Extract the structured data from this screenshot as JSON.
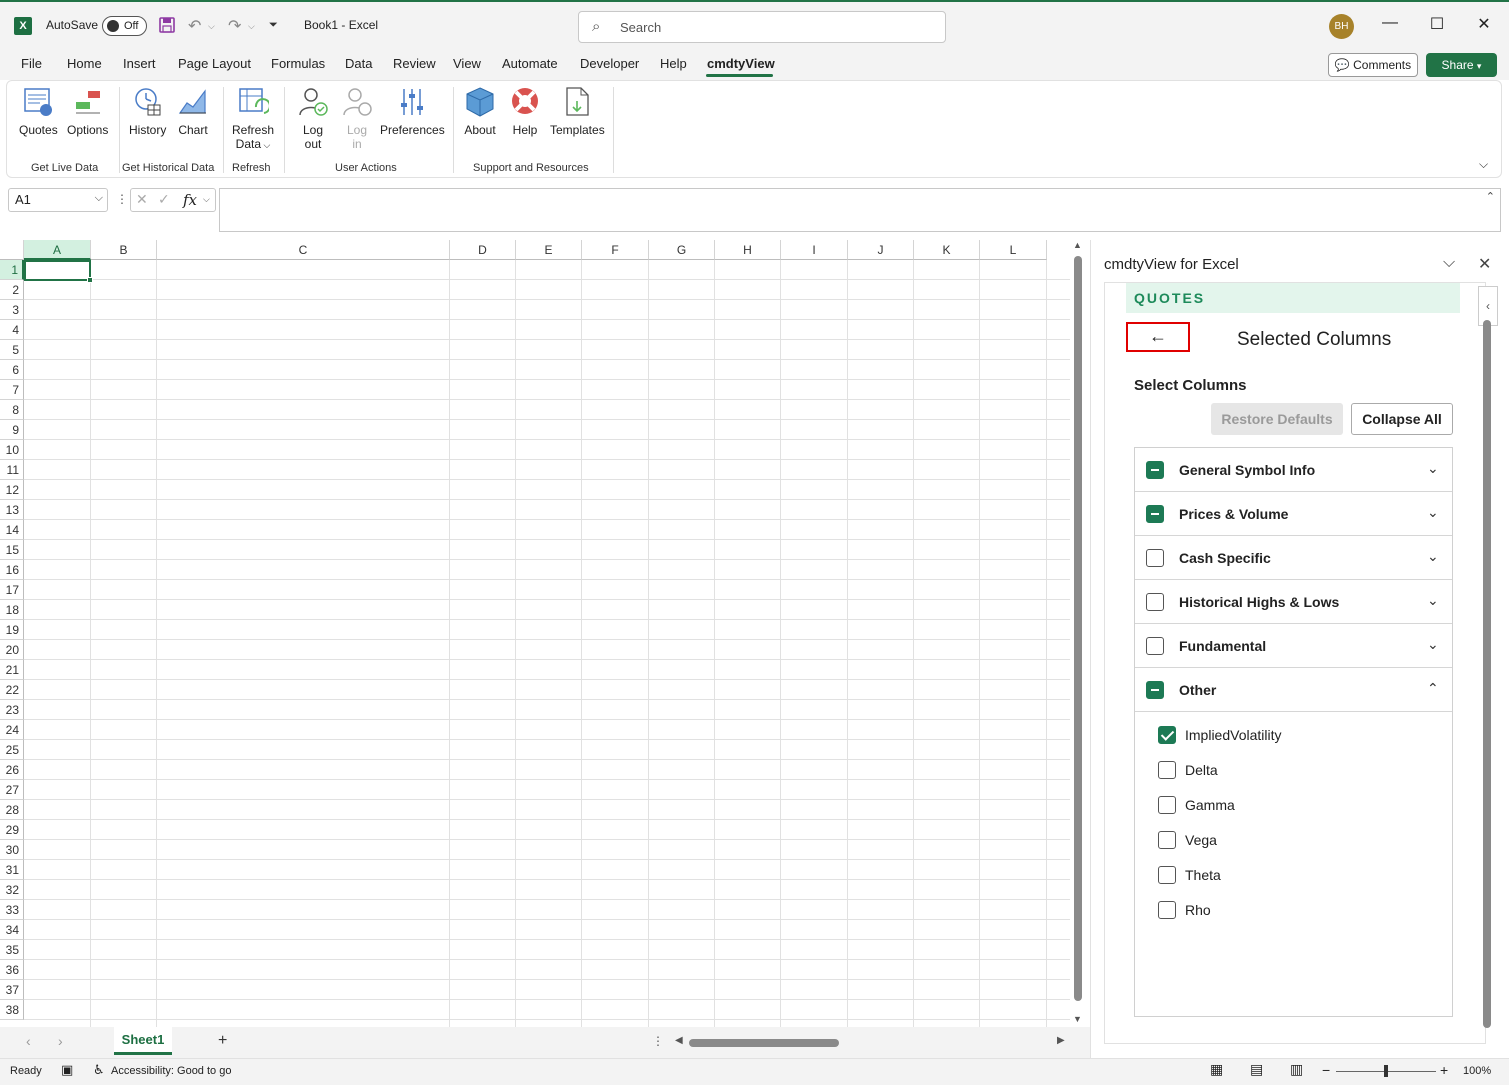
{
  "title_bar": {
    "app_icon": "excel-logo",
    "autosave_label": "AutoSave",
    "autosave_state": "Off",
    "doc_title": "Book1  -  Excel",
    "search_placeholder": "Search",
    "user_initials": "BH"
  },
  "menu": {
    "tabs": [
      "File",
      "Home",
      "Insert",
      "Page Layout",
      "Formulas",
      "Data",
      "Review",
      "View",
      "Automate",
      "Developer",
      "Help",
      "cmdtyView"
    ],
    "active_tab": "cmdtyView",
    "comments_label": "Comments",
    "share_label": "Share"
  },
  "ribbon": {
    "buttons": {
      "quotes": "Quotes",
      "options": "Options",
      "history": "History",
      "chart": "Chart",
      "refresh_line1": "Refresh",
      "refresh_line2": "Data",
      "logout_line1": "Log",
      "logout_line2": "out",
      "login_line1": "Log",
      "login_line2": "in",
      "preferences": "Preferences",
      "about": "About",
      "help": "Help",
      "templates": "Templates"
    },
    "groups": {
      "live": "Get Live Data",
      "historical": "Get Historical Data",
      "refresh": "Refresh",
      "user": "User Actions",
      "support": "Support and Resources"
    }
  },
  "formula_bar": {
    "name_box": "A1",
    "fx_label": "fx",
    "formula_value": ""
  },
  "grid": {
    "columns": [
      "A",
      "B",
      "C",
      "D",
      "E",
      "F",
      "G",
      "H",
      "I",
      "J",
      "K",
      "L"
    ],
    "rows": [
      "1",
      "2",
      "3",
      "4",
      "5",
      "6",
      "7",
      "8",
      "9",
      "10",
      "11",
      "12",
      "13",
      "14",
      "15",
      "16",
      "17",
      "18",
      "19",
      "20",
      "21",
      "22",
      "23",
      "24",
      "25",
      "26",
      "27",
      "28",
      "29",
      "30",
      "31",
      "32",
      "33",
      "34",
      "35",
      "36",
      "37",
      "38"
    ],
    "selected_column": "A",
    "selected_row": "1"
  },
  "sheets": {
    "tabs": [
      "Sheet1"
    ],
    "active": "Sheet1",
    "add_label": "+"
  },
  "status_bar": {
    "ready": "Ready",
    "accessibility": "Accessibility: Good to go",
    "zoom": "100%"
  },
  "task_pane": {
    "title": "cmdtyView for Excel",
    "section": "QUOTES",
    "back_icon": "arrow-left-icon",
    "heading": "Selected Columns",
    "select_label": "Select Columns",
    "restore_label": "Restore Defaults",
    "collapse_label": "Collapse All",
    "categories": [
      {
        "label": "General Symbol Info",
        "state": "partial",
        "expanded": false
      },
      {
        "label": "Prices & Volume",
        "state": "partial",
        "expanded": false
      },
      {
        "label": "Cash Specific",
        "state": "unchecked",
        "expanded": false
      },
      {
        "label": "Historical Highs & Lows",
        "state": "unchecked",
        "expanded": false
      },
      {
        "label": "Fundamental",
        "state": "unchecked",
        "expanded": false
      },
      {
        "label": "Other",
        "state": "partial",
        "expanded": true
      }
    ],
    "other_items": [
      {
        "label": "ImpliedVolatility",
        "checked": true
      },
      {
        "label": "Delta",
        "checked": false
      },
      {
        "label": "Gamma",
        "checked": false
      },
      {
        "label": "Vega",
        "checked": false
      },
      {
        "label": "Theta",
        "checked": false
      },
      {
        "label": "Rho",
        "checked": false
      }
    ]
  }
}
